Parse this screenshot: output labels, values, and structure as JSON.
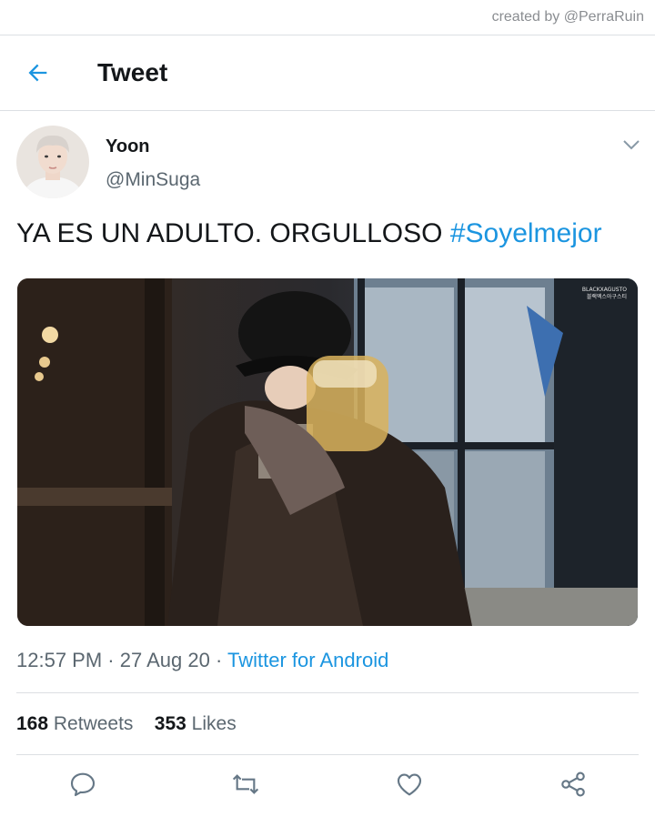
{
  "credit": "created by @PerraRuin",
  "header": {
    "title": "Tweet",
    "back_icon": "arrow-left-icon"
  },
  "tweet": {
    "author_name": "Yoon",
    "author_handle": "@MinSuga",
    "text": "YA ES UN ADULTO. ORGULLOSO",
    "hashtag": "#Soyelmejor",
    "media_watermark_line1": "BLACKXAGUSTO",
    "media_watermark_line2": "블랙엑스아구스티",
    "time": "12:57 PM",
    "date": "27 Aug 20",
    "separator": "·",
    "source": "Twitter for Android"
  },
  "stats": {
    "retweets_count": "168",
    "retweets_label": "Retweets",
    "likes_count": "353",
    "likes_label": "Likes"
  },
  "actions": [
    "reply-icon",
    "retweet-icon",
    "like-icon",
    "share-icon"
  ],
  "colors": {
    "accent": "#1b95e0",
    "text": "#14171a",
    "secondary": "#5b6770",
    "divider": "#dcdfe3"
  }
}
